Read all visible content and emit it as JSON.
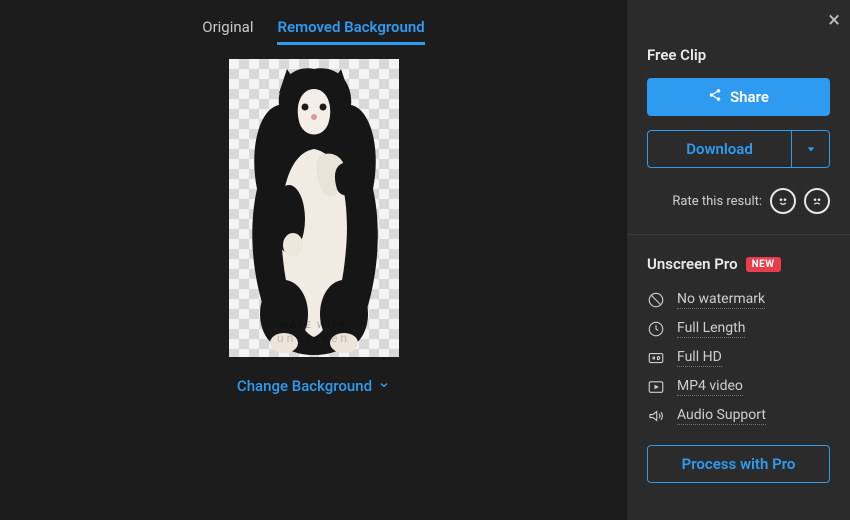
{
  "tabs": {
    "original": "Original",
    "removed": "Removed Background"
  },
  "watermark": {
    "line1": "MADE WITH",
    "line2": "unscreen"
  },
  "change_background": "Change Background",
  "sidebar": {
    "free_clip_title": "Free Clip",
    "share": "Share",
    "download": "Download",
    "rate_label": "Rate this result:",
    "pro_title": "Unscreen Pro",
    "new_badge": "NEW",
    "features": {
      "no_watermark": "No watermark",
      "full_length": "Full Length",
      "full_hd": "Full HD",
      "mp4": "MP4 video",
      "audio": "Audio Support"
    },
    "process_pro": "Process with Pro"
  }
}
